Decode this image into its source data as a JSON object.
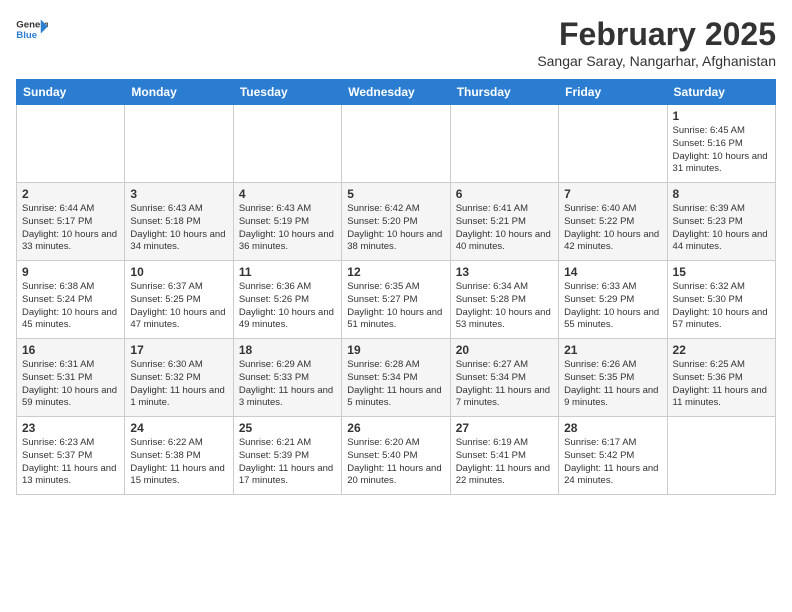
{
  "header": {
    "logo_general": "General",
    "logo_blue": "Blue",
    "month_year": "February 2025",
    "location": "Sangar Saray, Nangarhar, Afghanistan"
  },
  "days_of_week": [
    "Sunday",
    "Monday",
    "Tuesday",
    "Wednesday",
    "Thursday",
    "Friday",
    "Saturday"
  ],
  "weeks": [
    [
      {
        "day": "",
        "info": ""
      },
      {
        "day": "",
        "info": ""
      },
      {
        "day": "",
        "info": ""
      },
      {
        "day": "",
        "info": ""
      },
      {
        "day": "",
        "info": ""
      },
      {
        "day": "",
        "info": ""
      },
      {
        "day": "1",
        "info": "Sunrise: 6:45 AM\nSunset: 5:16 PM\nDaylight: 10 hours\nand 31 minutes."
      }
    ],
    [
      {
        "day": "2",
        "info": "Sunrise: 6:44 AM\nSunset: 5:17 PM\nDaylight: 10 hours\nand 33 minutes."
      },
      {
        "day": "3",
        "info": "Sunrise: 6:43 AM\nSunset: 5:18 PM\nDaylight: 10 hours\nand 34 minutes."
      },
      {
        "day": "4",
        "info": "Sunrise: 6:43 AM\nSunset: 5:19 PM\nDaylight: 10 hours\nand 36 minutes."
      },
      {
        "day": "5",
        "info": "Sunrise: 6:42 AM\nSunset: 5:20 PM\nDaylight: 10 hours\nand 38 minutes."
      },
      {
        "day": "6",
        "info": "Sunrise: 6:41 AM\nSunset: 5:21 PM\nDaylight: 10 hours\nand 40 minutes."
      },
      {
        "day": "7",
        "info": "Sunrise: 6:40 AM\nSunset: 5:22 PM\nDaylight: 10 hours\nand 42 minutes."
      },
      {
        "day": "8",
        "info": "Sunrise: 6:39 AM\nSunset: 5:23 PM\nDaylight: 10 hours\nand 44 minutes."
      }
    ],
    [
      {
        "day": "9",
        "info": "Sunrise: 6:38 AM\nSunset: 5:24 PM\nDaylight: 10 hours\nand 45 minutes."
      },
      {
        "day": "10",
        "info": "Sunrise: 6:37 AM\nSunset: 5:25 PM\nDaylight: 10 hours\nand 47 minutes."
      },
      {
        "day": "11",
        "info": "Sunrise: 6:36 AM\nSunset: 5:26 PM\nDaylight: 10 hours\nand 49 minutes."
      },
      {
        "day": "12",
        "info": "Sunrise: 6:35 AM\nSunset: 5:27 PM\nDaylight: 10 hours\nand 51 minutes."
      },
      {
        "day": "13",
        "info": "Sunrise: 6:34 AM\nSunset: 5:28 PM\nDaylight: 10 hours\nand 53 minutes."
      },
      {
        "day": "14",
        "info": "Sunrise: 6:33 AM\nSunset: 5:29 PM\nDaylight: 10 hours\nand 55 minutes."
      },
      {
        "day": "15",
        "info": "Sunrise: 6:32 AM\nSunset: 5:30 PM\nDaylight: 10 hours\nand 57 minutes."
      }
    ],
    [
      {
        "day": "16",
        "info": "Sunrise: 6:31 AM\nSunset: 5:31 PM\nDaylight: 10 hours\nand 59 minutes."
      },
      {
        "day": "17",
        "info": "Sunrise: 6:30 AM\nSunset: 5:32 PM\nDaylight: 11 hours\nand 1 minute."
      },
      {
        "day": "18",
        "info": "Sunrise: 6:29 AM\nSunset: 5:33 PM\nDaylight: 11 hours\nand 3 minutes."
      },
      {
        "day": "19",
        "info": "Sunrise: 6:28 AM\nSunset: 5:34 PM\nDaylight: 11 hours\nand 5 minutes."
      },
      {
        "day": "20",
        "info": "Sunrise: 6:27 AM\nSunset: 5:34 PM\nDaylight: 11 hours\nand 7 minutes."
      },
      {
        "day": "21",
        "info": "Sunrise: 6:26 AM\nSunset: 5:35 PM\nDaylight: 11 hours\nand 9 minutes."
      },
      {
        "day": "22",
        "info": "Sunrise: 6:25 AM\nSunset: 5:36 PM\nDaylight: 11 hours\nand 11 minutes."
      }
    ],
    [
      {
        "day": "23",
        "info": "Sunrise: 6:23 AM\nSunset: 5:37 PM\nDaylight: 11 hours\nand 13 minutes."
      },
      {
        "day": "24",
        "info": "Sunrise: 6:22 AM\nSunset: 5:38 PM\nDaylight: 11 hours\nand 15 minutes."
      },
      {
        "day": "25",
        "info": "Sunrise: 6:21 AM\nSunset: 5:39 PM\nDaylight: 11 hours\nand 17 minutes."
      },
      {
        "day": "26",
        "info": "Sunrise: 6:20 AM\nSunset: 5:40 PM\nDaylight: 11 hours\nand 20 minutes."
      },
      {
        "day": "27",
        "info": "Sunrise: 6:19 AM\nSunset: 5:41 PM\nDaylight: 11 hours\nand 22 minutes."
      },
      {
        "day": "28",
        "info": "Sunrise: 6:17 AM\nSunset: 5:42 PM\nDaylight: 11 hours\nand 24 minutes."
      },
      {
        "day": "",
        "info": ""
      }
    ]
  ]
}
